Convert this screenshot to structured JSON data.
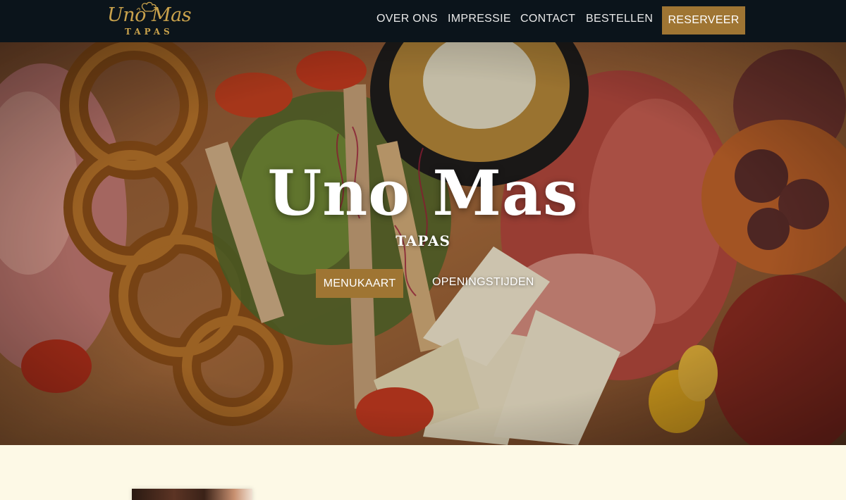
{
  "brand": {
    "logo_script": "Uno Mas",
    "logo_sub": "TAPAS",
    "color_gold": "#9f7533",
    "color_nav_bg": "#0b141b",
    "color_section_bg": "#fdf9e6"
  },
  "nav": {
    "items": [
      {
        "label": "OVER ONS"
      },
      {
        "label": "IMPRESSIE"
      },
      {
        "label": "CONTACT"
      },
      {
        "label": "BESTELLEN"
      }
    ],
    "reserve_label": "RESERVEER"
  },
  "hero": {
    "title": "Uno Mas",
    "subtitle": "TAPAS",
    "menu_button_label": "MENUKAART",
    "hours_link_label": "OPENINGSTIJDEN"
  }
}
